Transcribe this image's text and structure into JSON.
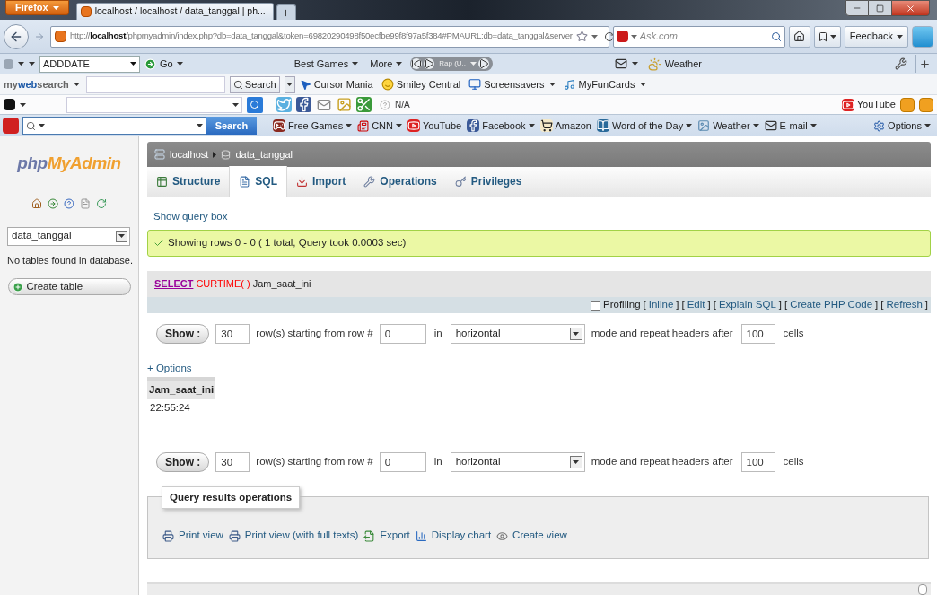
{
  "browser": {
    "menu_button": "Firefox",
    "tab_title": "localhost / localhost / data_tanggal | ph...",
    "url": "http://**localhost**/phpmyadmin/index.php?db=data_tanggal&token=69820290498f50ecfbe99f8f97a5f384#PMAURL:db=data_tanggal&server",
    "search_placeholder": "Ask.com",
    "feedback_button": "Feedback"
  },
  "toolbar_1": {
    "dropdown": "ADDDATE",
    "go_button": "Go",
    "menus": [
      "Best Games",
      "More"
    ],
    "player_title": "Rap (U..",
    "weather": "Weather"
  },
  "toolbar_2": {
    "brand": "my**web**search",
    "search_button": "Search",
    "links": [
      {
        "kind": "cursor",
        "label": "Cursor Mania",
        "menu": false
      },
      {
        "kind": "smiley",
        "label": "Smiley Central",
        "menu": false
      },
      {
        "kind": "screen",
        "label": "Screensavers",
        "menu": true
      },
      {
        "kind": "cards",
        "label": "MyFunCards",
        "menu": true
      }
    ]
  },
  "toolbar_3": {
    "status": "N/A",
    "youtube_link": "YouTube"
  },
  "toolbar_4": {
    "search_button": "Search",
    "links": [
      {
        "kind": "games",
        "label": "Free Games",
        "menu": true
      },
      {
        "kind": "news",
        "label": "CNN",
        "menu": true
      },
      {
        "kind": "video",
        "label": "YouTube",
        "menu": false
      },
      {
        "kind": "social",
        "label": "Facebook",
        "menu": true
      },
      {
        "kind": "shop",
        "label": "Amazon",
        "menu": false
      },
      {
        "kind": "dictionary",
        "label": "Word of the Day",
        "menu": true
      },
      {
        "kind": "weather",
        "label": "Weather",
        "menu": true
      },
      {
        "kind": "mail",
        "label": "E-mail",
        "menu": true
      }
    ],
    "options_button": "Options"
  },
  "sidebar": {
    "logo": "php**MyAdmin**",
    "database": "data_tanggal",
    "no_tables": "No tables found in database.",
    "create_table": "Create table"
  },
  "breadcrumb": [
    "localhost",
    "data_tanggal"
  ],
  "tabs": [
    {
      "kind": "structure",
      "label": "Structure",
      "selected": false
    },
    {
      "kind": "sql",
      "label": "SQL",
      "selected": true
    },
    {
      "kind": "import",
      "label": "Import",
      "selected": false
    },
    {
      "kind": "operations",
      "label": "Operations",
      "selected": false
    },
    {
      "kind": "privileges",
      "label": "Privileges",
      "selected": false
    }
  ],
  "show_query_box": "Show query box",
  "message": "Showing rows 0 - 0 ( 1 total, Query took 0.0003 sec)",
  "sql": [
    {
      "kind": "keyword",
      "text": "SELECT"
    },
    {
      "kind": "function",
      "text": "CURTIME( )"
    },
    {
      "kind": "identifier",
      "text": "Jam_saat_ini"
    }
  ],
  "profiling": {
    "label": "Profiling",
    "checked": false
  },
  "actions": [
    {
      "open": "[",
      "label": "Inline",
      "close": "]"
    },
    {
      "open": "[",
      "label": "Edit",
      "close": "]"
    },
    {
      "open": "[",
      "label": "Explain SQL",
      "close": "]"
    },
    {
      "open": "[",
      "label": "Create PHP Code",
      "close": "]"
    },
    {
      "open": "[",
      "label": "Refresh",
      "close": "]"
    }
  ],
  "navigation": [
    {
      "show_button": "Show :",
      "rows": "30",
      "rows_label": "row(s) starting from row #",
      "start": "0",
      "in_label": "in",
      "mode": "horizontal",
      "mode_label": "mode and repeat headers after",
      "repeat": "100",
      "cells_label": "cells"
    },
    {
      "show_button": "Show :",
      "rows": "30",
      "rows_label": "row(s) starting from row #",
      "start": "0",
      "in_label": "in",
      "mode": "horizontal",
      "mode_label": "mode and repeat headers after",
      "repeat": "100",
      "cells_label": "cells"
    }
  ],
  "options_link": "+ Options",
  "table": {
    "columns": [
      "Jam_saat_ini"
    ],
    "rows": [
      [
        "22:55:24"
      ]
    ]
  },
  "operations": {
    "legend": "Query results operations",
    "links": [
      {
        "kind": "print",
        "label": "Print view"
      },
      {
        "kind": "print",
        "label": "Print view (with full texts)"
      },
      {
        "kind": "export",
        "label": "Export"
      },
      {
        "kind": "chart",
        "label": "Display chart"
      },
      {
        "kind": "view",
        "label": "Create view"
      }
    ]
  }
}
